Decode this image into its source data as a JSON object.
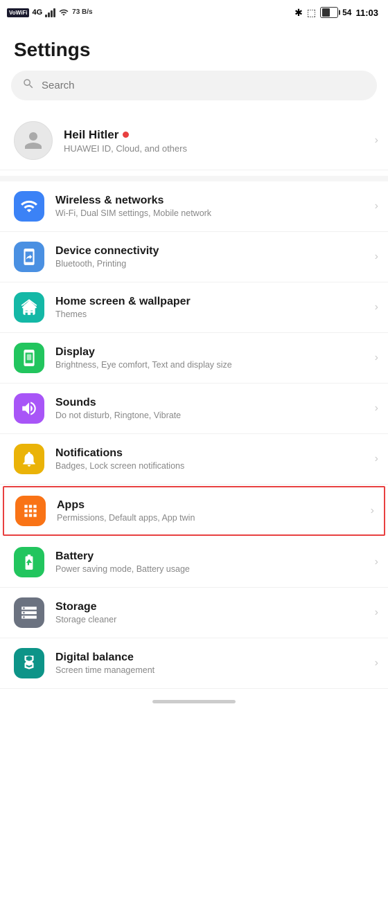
{
  "statusBar": {
    "leftItems": {
      "vowifi": "VoWiFi",
      "signal4g": "4G",
      "speed": "73 B/s"
    },
    "rightItems": {
      "bluetooth": "✱",
      "vibrate": "◫",
      "batteryPercent": "54",
      "time": "11:03"
    }
  },
  "pageTitle": "Settings",
  "search": {
    "placeholder": "Search"
  },
  "profile": {
    "name": "Heil Hitler",
    "subtext": "HUAWEI ID, Cloud, and others"
  },
  "settingsItems": [
    {
      "id": "wireless",
      "title": "Wireless & networks",
      "subtitle": "Wi-Fi, Dual SIM settings, Mobile network",
      "iconColor": "bg-blue",
      "iconType": "wifi"
    },
    {
      "id": "device-connectivity",
      "title": "Device connectivity",
      "subtitle": "Bluetooth, Printing",
      "iconColor": "bg-blue2",
      "iconType": "bluetooth"
    },
    {
      "id": "home-screen",
      "title": "Home screen & wallpaper",
      "subtitle": "Themes",
      "iconColor": "bg-teal",
      "iconType": "home"
    },
    {
      "id": "display",
      "title": "Display",
      "subtitle": "Brightness, Eye comfort, Text and display size",
      "iconColor": "bg-green2",
      "iconType": "display"
    },
    {
      "id": "sounds",
      "title": "Sounds",
      "subtitle": "Do not disturb, Ringtone, Vibrate",
      "iconColor": "bg-purple",
      "iconType": "sound"
    },
    {
      "id": "notifications",
      "title": "Notifications",
      "subtitle": "Badges, Lock screen notifications",
      "iconColor": "bg-yellow",
      "iconType": "bell"
    },
    {
      "id": "apps",
      "title": "Apps",
      "subtitle": "Permissions, Default apps, App twin",
      "iconColor": "bg-orange",
      "iconType": "apps",
      "highlighted": true
    },
    {
      "id": "battery",
      "title": "Battery",
      "subtitle": "Power saving mode, Battery usage",
      "iconColor": "bg-green",
      "iconType": "battery"
    },
    {
      "id": "storage",
      "title": "Storage",
      "subtitle": "Storage cleaner",
      "iconColor": "bg-gray",
      "iconType": "storage"
    },
    {
      "id": "digital-balance",
      "title": "Digital balance",
      "subtitle": "Screen time management",
      "iconColor": "bg-teal2",
      "iconType": "hourglass"
    }
  ]
}
